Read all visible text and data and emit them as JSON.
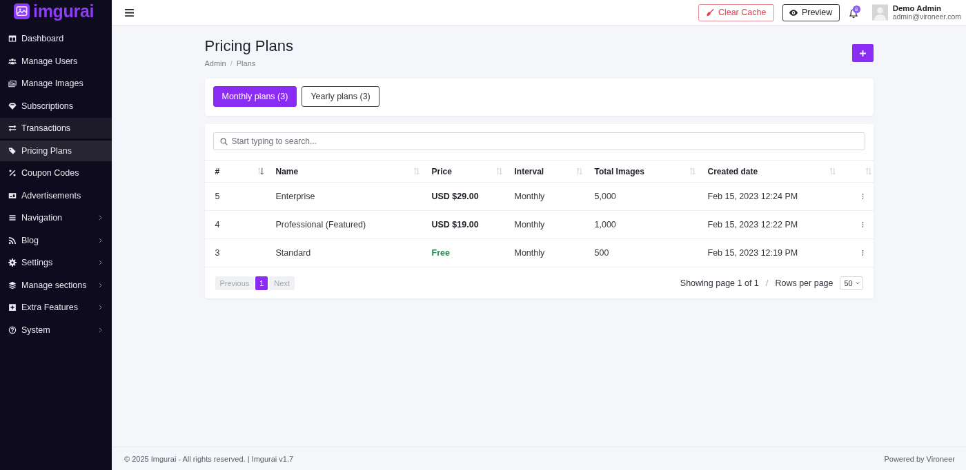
{
  "sidebar": {
    "logo": "imgurai",
    "items": [
      {
        "label": "Dashboard",
        "selected": false,
        "hovered": false,
        "has_submenu": false
      },
      {
        "label": "Manage Users",
        "selected": false,
        "hovered": false,
        "has_submenu": false
      },
      {
        "label": "Manage Images",
        "selected": false,
        "hovered": false,
        "has_submenu": false
      },
      {
        "label": "Subscriptions",
        "selected": false,
        "hovered": false,
        "has_submenu": false
      },
      {
        "label": "Transactions",
        "selected": false,
        "hovered": true,
        "has_submenu": false
      },
      {
        "label": "Pricing Plans",
        "selected": true,
        "hovered": false,
        "has_submenu": false
      },
      {
        "label": "Coupon Codes",
        "selected": false,
        "hovered": false,
        "has_submenu": false
      },
      {
        "label": "Advertisements",
        "selected": false,
        "hovered": false,
        "has_submenu": false
      },
      {
        "label": "Navigation",
        "selected": false,
        "hovered": false,
        "has_submenu": true
      },
      {
        "label": "Blog",
        "selected": false,
        "hovered": false,
        "has_submenu": true
      },
      {
        "label": "Settings",
        "selected": false,
        "hovered": false,
        "has_submenu": true
      },
      {
        "label": "Manage sections",
        "selected": false,
        "hovered": false,
        "has_submenu": true
      },
      {
        "label": "Extra Features",
        "selected": false,
        "hovered": false,
        "has_submenu": true
      },
      {
        "label": "System",
        "selected": false,
        "hovered": false,
        "has_submenu": true
      }
    ]
  },
  "topbar": {
    "clear_cache": "Clear Cache",
    "preview": "Preview",
    "notifications": "8",
    "user": {
      "name": "Demo Admin",
      "email": "admin@vironeer.com"
    }
  },
  "page": {
    "title": "Pricing Plans",
    "breadcrumb": {
      "items": [
        "Admin",
        "Plans"
      ],
      "separator": "/"
    }
  },
  "tabs": [
    {
      "label": "Monthly plans (3)",
      "selected": true
    },
    {
      "label": "Yearly plans (3)",
      "selected": false
    }
  ],
  "search": {
    "placeholder": "Start typing to search..."
  },
  "table": {
    "columns": [
      {
        "label": "#",
        "sorted": true
      },
      {
        "label": "Name",
        "sorted": false
      },
      {
        "label": "Price",
        "sorted": false
      },
      {
        "label": "Interval",
        "sorted": false
      },
      {
        "label": "Total Images",
        "sorted": false
      },
      {
        "label": "Created date",
        "sorted": false
      },
      {
        "sorted": false
      }
    ],
    "rows": [
      {
        "id": "5",
        "name": "Enterprise",
        "price": "USD $29.00",
        "free": false,
        "interval": "Monthly",
        "total_images": "5,000",
        "created": "Feb 15, 2023 12:24 PM"
      },
      {
        "id": "4",
        "name": "Professional (Featured)",
        "price": "USD $19.00",
        "free": false,
        "interval": "Monthly",
        "total_images": "1,000",
        "created": "Feb 15, 2023 12:22 PM"
      },
      {
        "id": "3",
        "name": "Standard",
        "price": "Free",
        "free": true,
        "interval": "Monthly",
        "total_images": "500",
        "created": "Feb 15, 2023 12:19 PM"
      }
    ]
  },
  "pagination": {
    "previous": {
      "label": "Previous",
      "disabled": true
    },
    "pages": [
      {
        "label": "1",
        "selected": true
      }
    ],
    "next": {
      "label": "Next",
      "disabled": true
    },
    "summary": "Showing page 1 of 1",
    "separator": "/",
    "rows_per_page_label": "Rows per page",
    "rows_per_page": "50"
  },
  "footer": {
    "copyright": "© 2025 Imgurai - All rights reserved. | Imgurai v1.7",
    "powered_by": "Powered by Vironeer"
  }
}
